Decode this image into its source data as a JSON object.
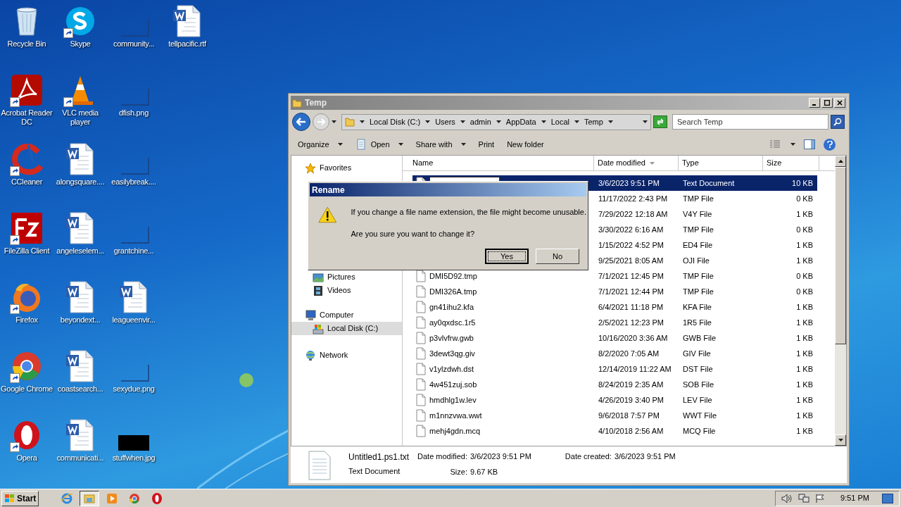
{
  "desktop": {
    "icons": [
      {
        "label": "Recycle Bin",
        "kind": "recycle",
        "shortcut": false
      },
      {
        "label": "Acrobat Reader DC",
        "kind": "acrobat",
        "shortcut": true
      },
      {
        "label": "CCleaner",
        "kind": "ccleaner",
        "shortcut": true
      },
      {
        "label": "FileZilla Client",
        "kind": "filezilla",
        "shortcut": true
      },
      {
        "label": "Firefox",
        "kind": "firefox",
        "shortcut": true
      },
      {
        "label": "Google Chrome",
        "kind": "chrome",
        "shortcut": true
      },
      {
        "label": "Opera",
        "kind": "opera",
        "shortcut": true
      },
      {
        "label": "Skype",
        "kind": "skype",
        "shortcut": true
      },
      {
        "label": "VLC media player",
        "kind": "vlc",
        "shortcut": true
      },
      {
        "label": "alongsquare....",
        "kind": "word",
        "shortcut": false
      },
      {
        "label": "angeleselem...",
        "kind": "word",
        "shortcut": false
      },
      {
        "label": "beyondext...",
        "kind": "word",
        "shortcut": false
      },
      {
        "label": "coastsearch...",
        "kind": "word",
        "shortcut": false
      },
      {
        "label": "communicati...",
        "kind": "word",
        "shortcut": false
      },
      {
        "label": "community...",
        "kind": "image",
        "shortcut": false
      },
      {
        "label": "dfish.png",
        "kind": "image",
        "shortcut": false
      },
      {
        "label": "easilybreak....",
        "kind": "image",
        "shortcut": false
      },
      {
        "label": "grantchine...",
        "kind": "image",
        "shortcut": false
      },
      {
        "label": "leagueenvir...",
        "kind": "word",
        "shortcut": false
      },
      {
        "label": "sexydue.png",
        "kind": "image",
        "shortcut": false
      },
      {
        "label": "stuffwhen.jpg",
        "kind": "dark-image",
        "shortcut": false
      },
      {
        "label": "tellpacific.rtf",
        "kind": "word",
        "shortcut": false
      }
    ]
  },
  "window": {
    "title": "Temp",
    "breadcrumbs": [
      "Local Disk (C:)",
      "Users",
      "admin",
      "AppData",
      "Local",
      "Temp"
    ],
    "search": {
      "placeholder": "Search Temp"
    },
    "toolbar": [
      {
        "label": "Organize",
        "dropdown": true,
        "kind": "text"
      },
      {
        "label": "Open",
        "dropdown": true,
        "kind": "notepad"
      },
      {
        "label": "Share with",
        "dropdown": true,
        "kind": "text"
      },
      {
        "label": "Print",
        "dropdown": false,
        "kind": "text"
      },
      {
        "label": "New folder",
        "dropdown": false,
        "kind": "text"
      }
    ],
    "nav": [
      {
        "label": "Favorites",
        "kind": "star",
        "selected": false
      },
      {
        "label": "Pictures",
        "kind": "pictures",
        "selected": false
      },
      {
        "label": "Videos",
        "kind": "videos",
        "selected": false
      },
      {
        "label": "Computer",
        "kind": "computer",
        "selected": false,
        "children": [
          {
            "label": "Local Disk (C:)",
            "kind": "disk",
            "selected": true
          }
        ]
      },
      {
        "label": "Network",
        "kind": "network",
        "selected": false
      }
    ],
    "columns": [
      {
        "label": "Name",
        "sorted": false
      },
      {
        "label": "Date modified",
        "sorted": true
      },
      {
        "label": "Type",
        "sorted": false
      },
      {
        "label": "Size",
        "sorted": false
      }
    ],
    "files": [
      {
        "date": "3/6/2023 9:51 PM",
        "type": "Text Document",
        "size": "10 KB",
        "selected": true,
        "renaming": true
      },
      {
        "date": "11/17/2022 2:43 PM",
        "type": "TMP File",
        "size": "0 KB",
        "selected": false
      },
      {
        "date": "7/29/2022 12:18 AM",
        "type": "V4Y File",
        "size": "1 KB",
        "selected": false
      },
      {
        "date": "3/30/2022 6:16 AM",
        "type": "TMP File",
        "size": "0 KB",
        "selected": false
      },
      {
        "date": "1/15/2022 4:52 PM",
        "type": "ED4 File",
        "size": "1 KB",
        "selected": false
      },
      {
        "date": "9/25/2021 8:05 AM",
        "type": "OJI File",
        "size": "1 KB",
        "selected": false
      },
      {
        "name": "DMI5D92.tmp",
        "date": "7/1/2021 12:45 PM",
        "type": "TMP File",
        "size": "0 KB",
        "selected": false
      },
      {
        "name": "DMI326A.tmp",
        "date": "7/1/2021 12:44 PM",
        "type": "TMP File",
        "size": "0 KB",
        "selected": false
      },
      {
        "name": "gn41ihu2.kfa",
        "date": "6/4/2021 11:18 PM",
        "type": "KFA File",
        "size": "1 KB",
        "selected": false
      },
      {
        "name": "ay0qxdsc.1r5",
        "date": "2/5/2021 12:23 PM",
        "type": "1R5 File",
        "size": "1 KB",
        "selected": false
      },
      {
        "name": "p3vlvfrw.gwb",
        "date": "10/16/2020 3:36 AM",
        "type": "GWB File",
        "size": "1 KB",
        "selected": false
      },
      {
        "name": "3dewt3qg.giv",
        "date": "8/2/2020 7:05 AM",
        "type": "GIV File",
        "size": "1 KB",
        "selected": false
      },
      {
        "name": "v1ylzdwh.dst",
        "date": "12/14/2019 11:22 AM",
        "type": "DST File",
        "size": "1 KB",
        "selected": false
      },
      {
        "name": "4w451zuj.sob",
        "date": "8/24/2019 2:35 AM",
        "type": "SOB File",
        "size": "1 KB",
        "selected": false
      },
      {
        "name": "hmdhlg1w.lev",
        "date": "4/26/2019 3:40 PM",
        "type": "LEV File",
        "size": "1 KB",
        "selected": false
      },
      {
        "name": "m1nnzvwa.wwt",
        "date": "9/6/2018 7:57 PM",
        "type": "WWT File",
        "size": "1 KB",
        "selected": false
      },
      {
        "name": "mehj4gdn.mcq",
        "date": "4/10/2018 2:56 AM",
        "type": "MCQ File",
        "size": "1 KB",
        "selected": false
      }
    ],
    "details": {
      "name": "Untitled1.ps1.txt",
      "type": "Text Document",
      "fields": [
        {
          "label": "Date modified:",
          "value": "3/6/2023 9:51 PM"
        },
        {
          "label": "Size:",
          "value": "9.67 KB"
        },
        {
          "label": "Date created:",
          "value": "3/6/2023 9:51 PM"
        }
      ]
    }
  },
  "dialog": {
    "title": "Rename",
    "messages": [
      "If you change a file name extension, the file might become unusable.",
      "Are you sure you want to change it?"
    ],
    "buttons": [
      {
        "label": "Yes",
        "default": true
      },
      {
        "label": "No",
        "default": false
      }
    ]
  },
  "taskbar": {
    "start": "Start",
    "apps": [
      {
        "kind": "ie",
        "active": false
      },
      {
        "kind": "explorer",
        "active": true
      },
      {
        "kind": "media",
        "active": false
      },
      {
        "kind": "chrome",
        "active": false
      },
      {
        "kind": "opera",
        "active": false
      }
    ],
    "time": "9:51 PM"
  }
}
